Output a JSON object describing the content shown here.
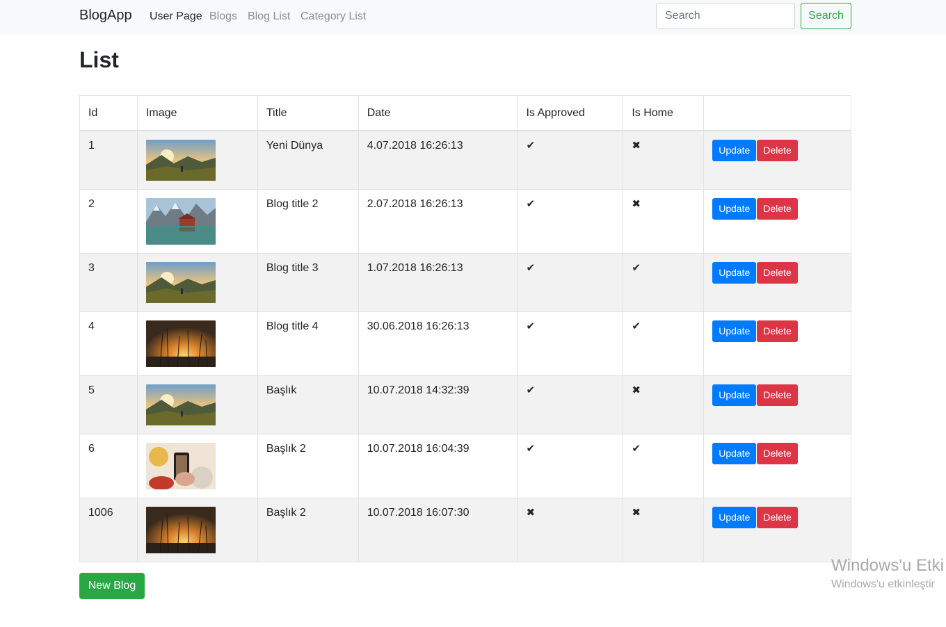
{
  "navbar": {
    "brand": "BlogApp",
    "links": [
      "User Page",
      "Blogs",
      "Blog List",
      "Category List"
    ],
    "search_placeholder": "Search",
    "search_button": "Search"
  },
  "page": {
    "title": "List"
  },
  "table": {
    "headers": [
      "Id",
      "Image",
      "Title",
      "Date",
      "Is Approved",
      "Is Home",
      ""
    ],
    "update_label": "Update",
    "delete_label": "Delete",
    "rows": [
      {
        "id": "1",
        "title": "Yeni Dünya",
        "date": "4.07.2018 16:26:13",
        "approved": "✔",
        "home": "✖"
      },
      {
        "id": "2",
        "title": "Blog title 2",
        "date": "2.07.2018 16:26:13",
        "approved": "✔",
        "home": "✖"
      },
      {
        "id": "3",
        "title": "Blog title 3",
        "date": "1.07.2018 16:26:13",
        "approved": "✔",
        "home": "✔"
      },
      {
        "id": "4",
        "title": "Blog title 4",
        "date": "30.06.2018 16:26:13",
        "approved": "✔",
        "home": "✔"
      },
      {
        "id": "5",
        "title": "Başlık",
        "date": "10.07.2018 14:32:39",
        "approved": "✔",
        "home": "✖"
      },
      {
        "id": "6",
        "title": "Başlık 2",
        "date": "10.07.2018 16:04:39",
        "approved": "✔",
        "home": "✔"
      },
      {
        "id": "1006",
        "title": "Başlık 2",
        "date": "10.07.2018 16:07:30",
        "approved": "✖",
        "home": "✖"
      }
    ]
  },
  "new_blog_button": "New Blog",
  "watermark": {
    "title": "Windows'u Etki",
    "subtitle": "Windows'u etkinleştir"
  },
  "colors": {
    "primary": "#007bff",
    "danger": "#dc3545",
    "success": "#28a745"
  }
}
